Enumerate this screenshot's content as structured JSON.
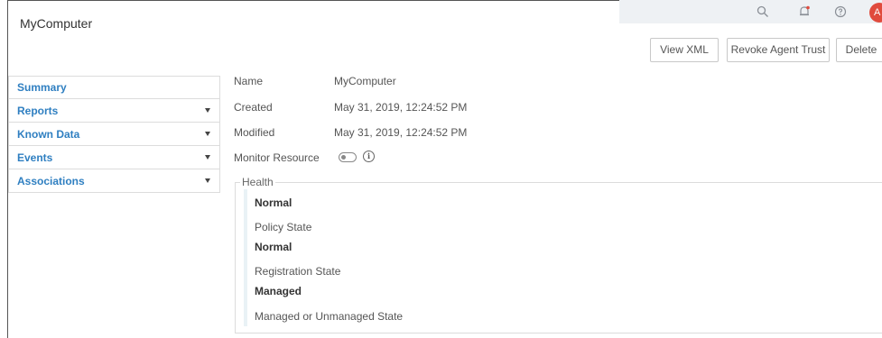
{
  "window": {
    "title": "MyComputer",
    "avatar_letter": "A"
  },
  "toolbar": {
    "view_xml": "View XML",
    "revoke": "Revoke Agent Trust",
    "delete": "Delete"
  },
  "sidebar": {
    "items": [
      {
        "label": "Summary",
        "has_caret": false
      },
      {
        "label": "Reports",
        "has_caret": true
      },
      {
        "label": "Known Data",
        "has_caret": true
      },
      {
        "label": "Events",
        "has_caret": true
      },
      {
        "label": "Associations",
        "has_caret": true
      }
    ]
  },
  "details": {
    "name_label": "Name",
    "name_value": "MyComputer",
    "created_label": "Created",
    "created_value": "May 31, 2019, 12:24:52 PM",
    "modified_label": "Modified",
    "modified_value": "May 31, 2019, 12:24:52 PM",
    "monitor_label": "Monitor Resource",
    "monitor_enabled": false
  },
  "health": {
    "legend": "Health",
    "rows": [
      {
        "value": "Normal",
        "label": "Policy State"
      },
      {
        "value": "Normal",
        "label": "Registration State"
      },
      {
        "value": "Managed",
        "label": "Managed or Unmanaged State"
      }
    ]
  },
  "colors": {
    "accent": "#2f7fc1",
    "avatar": "#e04b3d"
  }
}
